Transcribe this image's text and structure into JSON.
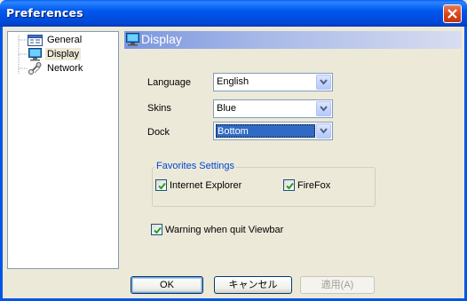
{
  "window": {
    "title": "Preferences"
  },
  "tree": {
    "items": [
      {
        "label": "General",
        "icon": "general-settings-icon",
        "selected": false
      },
      {
        "label": "Display",
        "icon": "monitor-icon",
        "selected": true
      },
      {
        "label": "Network",
        "icon": "network-icon",
        "selected": false
      }
    ]
  },
  "panel": {
    "title": "Display",
    "language": {
      "label": "Language",
      "value": "English"
    },
    "skins": {
      "label": "Skins",
      "value": "Blue"
    },
    "dock": {
      "label": "Dock",
      "value": "Bottom"
    },
    "favorites": {
      "legend": "Favorites Settings",
      "internet_explorer": {
        "label": "Internet Explorer",
        "checked": true
      },
      "firefox": {
        "label": "FireFox",
        "checked": true
      }
    },
    "warning": {
      "label": "Warning when quit Viewbar",
      "checked": true
    }
  },
  "buttons": {
    "ok": "OK",
    "cancel": "キャンセル",
    "apply": "適用(A)"
  },
  "colors": {
    "title_bar": "#0058ee",
    "accent": "#316ac5",
    "close": "#d9441b",
    "group_legend": "#0046d5",
    "check": "#21a121"
  }
}
